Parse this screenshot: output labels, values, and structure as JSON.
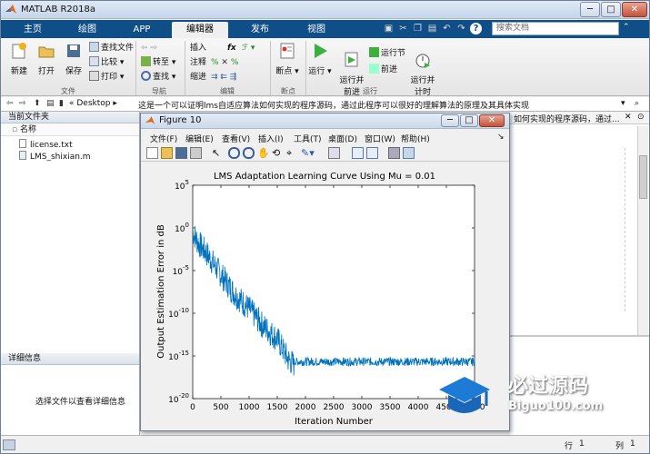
{
  "window": {
    "title": "MATLAB R2018a",
    "btn_min": "─",
    "btn_max": "□",
    "btn_close": "✕"
  },
  "tabs": [
    {
      "label": "主页"
    },
    {
      "label": "绘图"
    },
    {
      "label": "APP"
    },
    {
      "label": "编辑器",
      "active": true
    },
    {
      "label": "发布"
    },
    {
      "label": "视图"
    }
  ],
  "search": {
    "placeholder": "搜索文档"
  },
  "ribbon": {
    "new_label": "新建",
    "open_label": "打开",
    "save_label": "保存",
    "find_files": "查找文件",
    "compare": "比较",
    "print": "打印",
    "goto": "转至",
    "find": "查找",
    "insert": "插入",
    "comment": "注释",
    "indent": "缩进",
    "fx": "fx",
    "breakpoints": "断点",
    "run": "运行",
    "run_advance": "运行并\n前进",
    "run_section": "运行节",
    "advance": "前进",
    "run_time": "运行并\n计时",
    "groups": {
      "file": "文件",
      "nav": "导航",
      "edit": "编辑",
      "breakpoints": "断点",
      "run": "运行"
    }
  },
  "pathbar": {
    "location": "Desktop",
    "description": "这是一个可以证明lms自适应算法如何实现的程序源码，通过此程序可以很好的理解算法的原理及其具体实现",
    "right_text": "如何实现的程序源码，通过..."
  },
  "current_folder": {
    "title": "当前文件夹",
    "column": "名称",
    "files": [
      {
        "name": "license.txt"
      },
      {
        "name": "LMS_shixian.m"
      }
    ]
  },
  "details": {
    "title": "详细信息",
    "empty": "选择文件以查看详细信息"
  },
  "status": {
    "row_label": "行",
    "row": "1",
    "col_label": "列",
    "col": "1"
  },
  "figure": {
    "title": "Figure 10",
    "menus": [
      "文件(F)",
      "编辑(E)",
      "查看(V)",
      "插入(I)",
      "工具(T)",
      "桌面(D)",
      "窗口(W)",
      "帮助(H)"
    ],
    "arrow": "↘"
  },
  "watermark": {
    "brand": "必过源码",
    "url": "Biguo100.com"
  },
  "colors": {
    "tabbar": "#0f4e86",
    "line": "#0072bd",
    "accent": "#3a8ee6"
  },
  "chart_data": {
    "type": "line",
    "title": "LMS Adaptation Learning Curve Using Mu = 0.01",
    "xlabel": "Iteration Number",
    "ylabel": "Output Estimation Error in dB",
    "xlim": [
      0,
      5000
    ],
    "ylim": [
      1e-20,
      100000.0
    ],
    "yscale": "log",
    "xticks": [
      0,
      500,
      1000,
      1500,
      2000,
      2500,
      3000,
      3500,
      4000,
      4500,
      5000
    ],
    "yticks": [
      {
        "value": 100000.0,
        "base": "10",
        "exp": "5"
      },
      {
        "value": 1,
        "base": "10",
        "exp": "0"
      },
      {
        "value": 1e-05,
        "base": "10",
        "exp": "-5"
      },
      {
        "value": 1e-10,
        "base": "10",
        "exp": "-10"
      },
      {
        "value": 1e-15,
        "base": "10",
        "exp": "-15"
      },
      {
        "value": 1e-20,
        "base": "10",
        "exp": "-20"
      }
    ],
    "series": [
      {
        "x": [
          0,
          100,
          250,
          500,
          750,
          1000,
          1250,
          1500,
          1700,
          1800,
          2000,
          2500,
          3000,
          3500,
          4000,
          4500,
          5000
        ],
        "y": [
          1,
          0.05,
          0.003,
          1e-05,
          5e-08,
          1e-09,
          1e-11,
          3e-13,
          1e-15,
          3e-16,
          3e-16,
          3e-16,
          3e-16,
          3e-16,
          3e-16,
          3e-16,
          3e-16
        ]
      }
    ],
    "grid": false
  }
}
